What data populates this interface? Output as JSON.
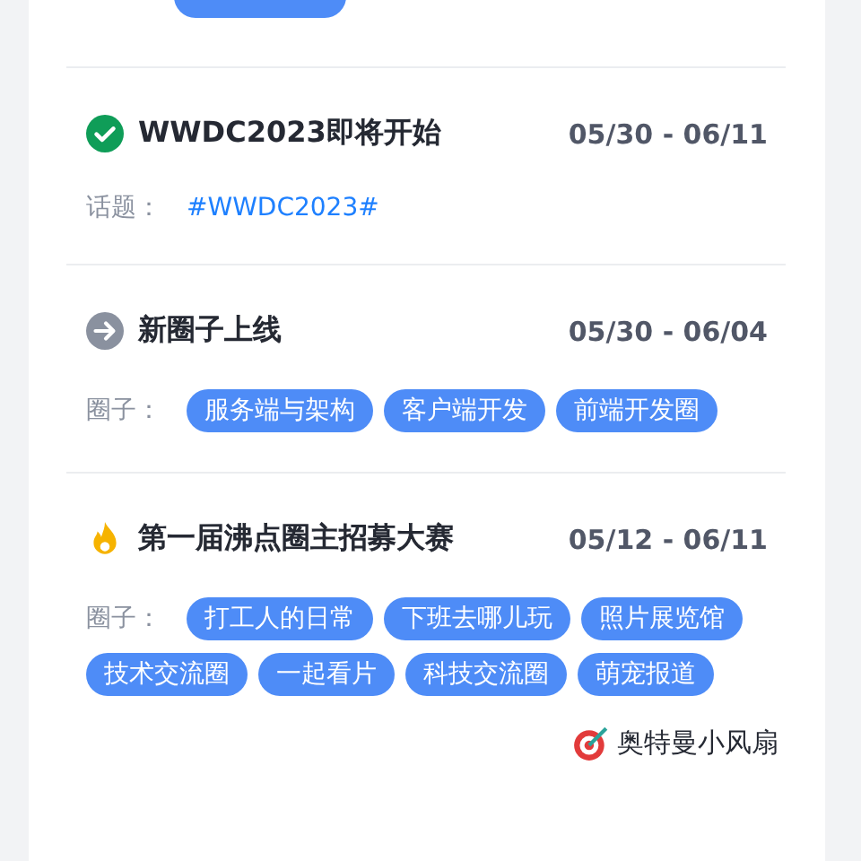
{
  "events": [
    {
      "kind": "done",
      "title": "WWDC2023即将开始",
      "dates": "05/30 - 06/11",
      "meta": {
        "kind": "topic",
        "label": "话题：",
        "items": [
          "#WWDC2023#"
        ]
      }
    },
    {
      "kind": "new",
      "title": "新圈子上线",
      "dates": "05/30 - 06/04",
      "meta": {
        "kind": "circles",
        "label": "圈子：",
        "items": [
          "服务端与架构",
          "客户端开发",
          "前端开发圈"
        ]
      }
    },
    {
      "kind": "hot",
      "title": "第一届沸点圈主招募大赛",
      "dates": "05/12 - 06/11",
      "meta": {
        "kind": "circles",
        "label": "圈子：",
        "items": [
          "打工人的日常",
          "下班去哪儿玩",
          "照片展览馆",
          "技术交流圈",
          "一起看片",
          "科技交流圈",
          "萌宠报道"
        ]
      }
    }
  ],
  "author": {
    "name": "奥特曼小风扇"
  }
}
